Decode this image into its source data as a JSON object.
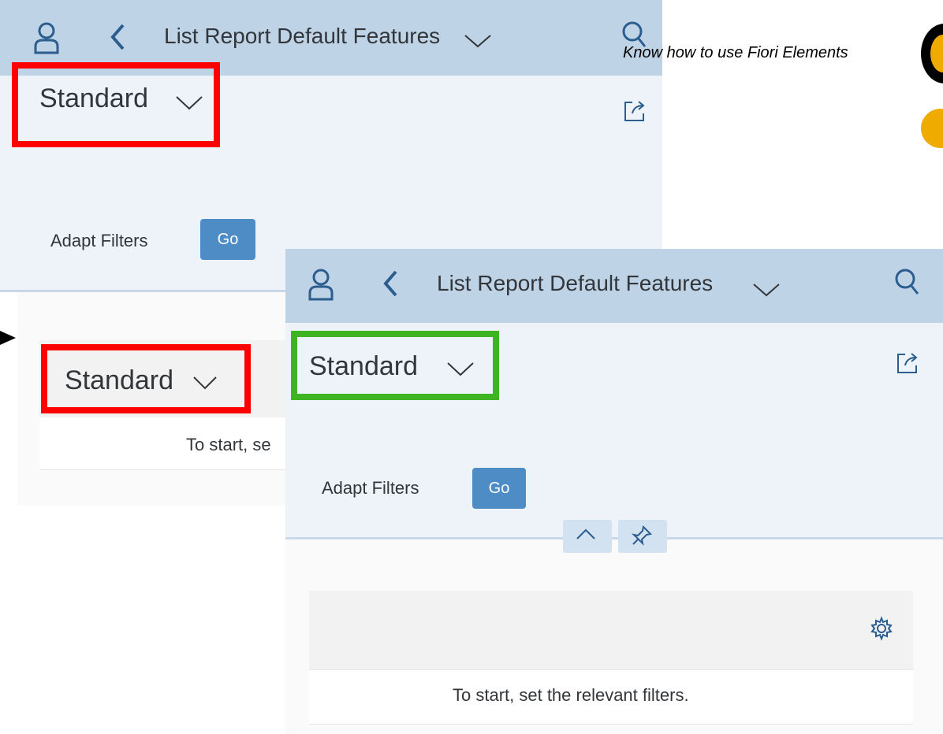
{
  "header_note": "Know how to use Fiori Elements",
  "back_window": {
    "title": "List Report Default Features",
    "variant": "Standard",
    "adapt_filters": "Adapt Filters",
    "go": "Go",
    "table_variant": "Standard",
    "message_partial": "To start, se"
  },
  "front_window": {
    "title": "List Report Default Features",
    "variant": "Standard",
    "adapt_filters": "Adapt Filters",
    "go": "Go",
    "message": "To start, set the relevant filters."
  },
  "colors": {
    "shell": "#bfd3e6",
    "panel": "#edf3f9",
    "highlight_red": "#ff0000",
    "highlight_green": "#3cb521",
    "button": "#4d8cc4",
    "accent_orange": "#f0ab00"
  },
  "icons": [
    "user-icon",
    "back-icon",
    "chevron-down-icon",
    "search-icon",
    "share-icon",
    "collapse-icon",
    "pin-icon",
    "settings-icon",
    "arrow-icon"
  ]
}
